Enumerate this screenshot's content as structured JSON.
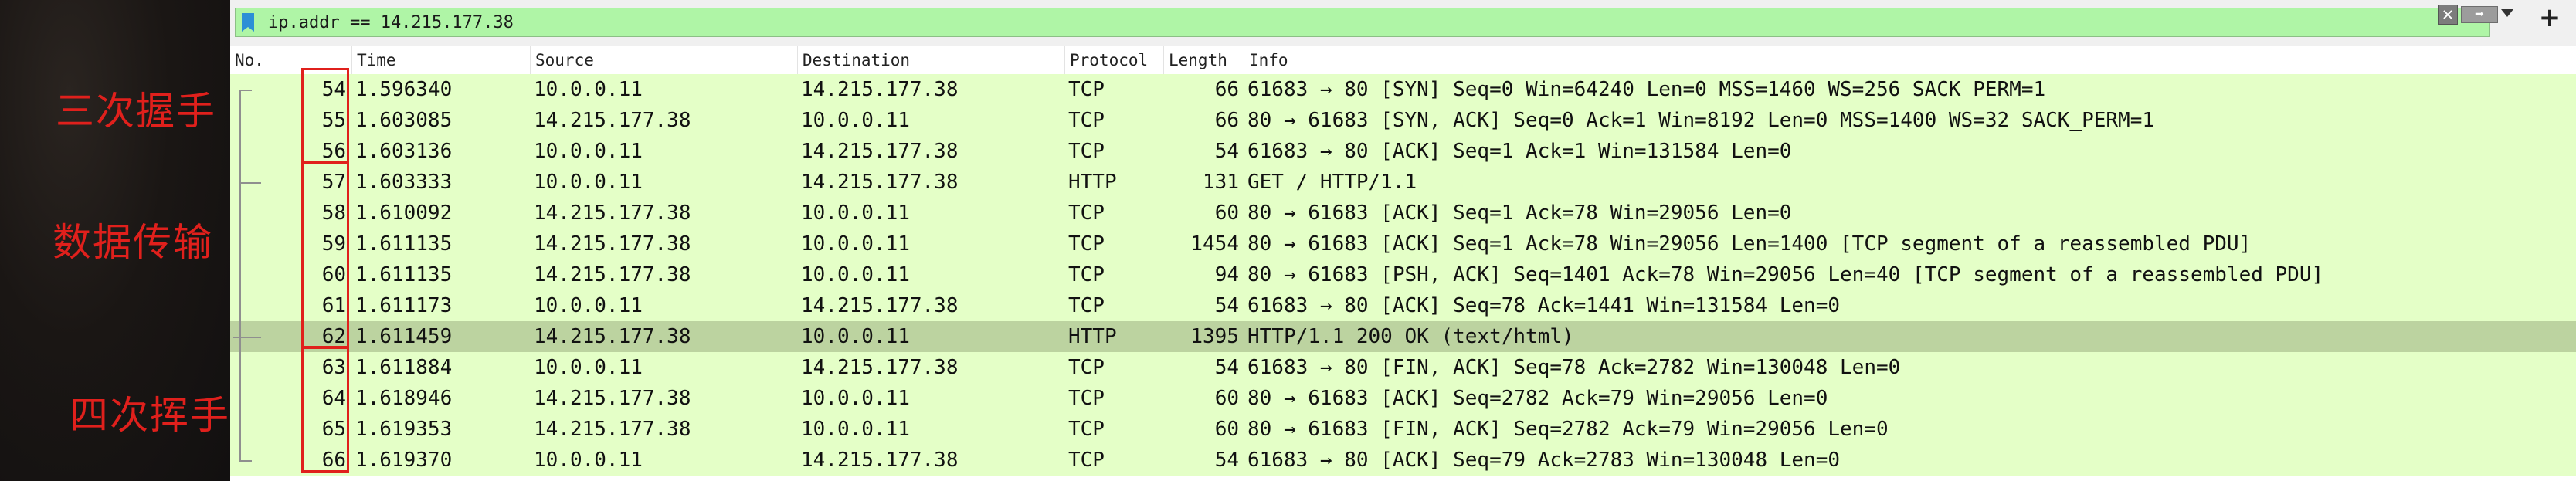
{
  "annotations": {
    "handshake": "三次握手",
    "data_transfer": "数据传输",
    "teardown": "四次挥手"
  },
  "filter": {
    "value": "ip.addr == 14.215.177.38",
    "clear_icon": "clear-x-icon",
    "apply_icon": "apply-arrow-icon",
    "dropdown_icon": "chevron-down-icon",
    "add_icon": "plus-icon"
  },
  "columns": {
    "no": "No.",
    "time": "Time",
    "source": "Source",
    "destination": "Destination",
    "protocol": "Protocol",
    "length": "Length",
    "info": "Info"
  },
  "packets": [
    {
      "no": "54",
      "time": "1.596340",
      "source": "10.0.0.11",
      "destination": "14.215.177.38",
      "protocol": "TCP",
      "length": "66",
      "info": "61683 → 80 [SYN] Seq=0 Win=64240 Len=0 MSS=1460 WS=256 SACK_PERM=1"
    },
    {
      "no": "55",
      "time": "1.603085",
      "source": "14.215.177.38",
      "destination": "10.0.0.11",
      "protocol": "TCP",
      "length": "66",
      "info": "80 → 61683 [SYN, ACK] Seq=0 Ack=1 Win=8192 Len=0 MSS=1400 WS=32 SACK_PERM=1"
    },
    {
      "no": "56",
      "time": "1.603136",
      "source": "10.0.0.11",
      "destination": "14.215.177.38",
      "protocol": "TCP",
      "length": "54",
      "info": "61683 → 80 [ACK] Seq=1 Ack=1 Win=131584 Len=0"
    },
    {
      "no": "57",
      "time": "1.603333",
      "source": "10.0.0.11",
      "destination": "14.215.177.38",
      "protocol": "HTTP",
      "length": "131",
      "info": "GET / HTTP/1.1"
    },
    {
      "no": "58",
      "time": "1.610092",
      "source": "14.215.177.38",
      "destination": "10.0.0.11",
      "protocol": "TCP",
      "length": "60",
      "info": "80 → 61683 [ACK] Seq=1 Ack=78 Win=29056 Len=0"
    },
    {
      "no": "59",
      "time": "1.611135",
      "source": "14.215.177.38",
      "destination": "10.0.0.11",
      "protocol": "TCP",
      "length": "1454",
      "info": "80 → 61683 [ACK] Seq=1 Ack=78 Win=29056 Len=1400 [TCP segment of a reassembled PDU]"
    },
    {
      "no": "60",
      "time": "1.611135",
      "source": "14.215.177.38",
      "destination": "10.0.0.11",
      "protocol": "TCP",
      "length": "94",
      "info": "80 → 61683 [PSH, ACK] Seq=1401 Ack=78 Win=29056 Len=40 [TCP segment of a reassembled PDU]"
    },
    {
      "no": "61",
      "time": "1.611173",
      "source": "10.0.0.11",
      "destination": "14.215.177.38",
      "protocol": "TCP",
      "length": "54",
      "info": "61683 → 80 [ACK] Seq=78 Ack=1441 Win=131584 Len=0"
    },
    {
      "no": "62",
      "time": "1.611459",
      "source": "14.215.177.38",
      "destination": "10.0.0.11",
      "protocol": "HTTP",
      "length": "1395",
      "info": "HTTP/1.1 200 OK  (text/html)"
    },
    {
      "no": "63",
      "time": "1.611884",
      "source": "10.0.0.11",
      "destination": "14.215.177.38",
      "protocol": "TCP",
      "length": "54",
      "info": "61683 → 80 [FIN, ACK] Seq=78 Ack=2782 Win=130048 Len=0"
    },
    {
      "no": "64",
      "time": "1.618946",
      "source": "14.215.177.38",
      "destination": "10.0.0.11",
      "protocol": "TCP",
      "length": "60",
      "info": "80 → 61683 [ACK] Seq=2782 Ack=79 Win=29056 Len=0"
    },
    {
      "no": "65",
      "time": "1.619353",
      "source": "14.215.177.38",
      "destination": "10.0.0.11",
      "protocol": "TCP",
      "length": "60",
      "info": "80 → 61683 [FIN, ACK] Seq=2782 Ack=79 Win=29056 Len=0"
    },
    {
      "no": "66",
      "time": "1.619370",
      "source": "10.0.0.11",
      "destination": "14.215.177.38",
      "protocol": "TCP",
      "length": "54",
      "info": "61683 → 80 [ACK] Seq=79 Ack=2783 Win=130048 Len=0"
    }
  ],
  "selected_packet": "62",
  "colors": {
    "row_background": "#e4ffc7",
    "selected_row_background": "#bcd3a0",
    "filter_background": "#aff5a6",
    "annotation_red": "#e0201c"
  }
}
